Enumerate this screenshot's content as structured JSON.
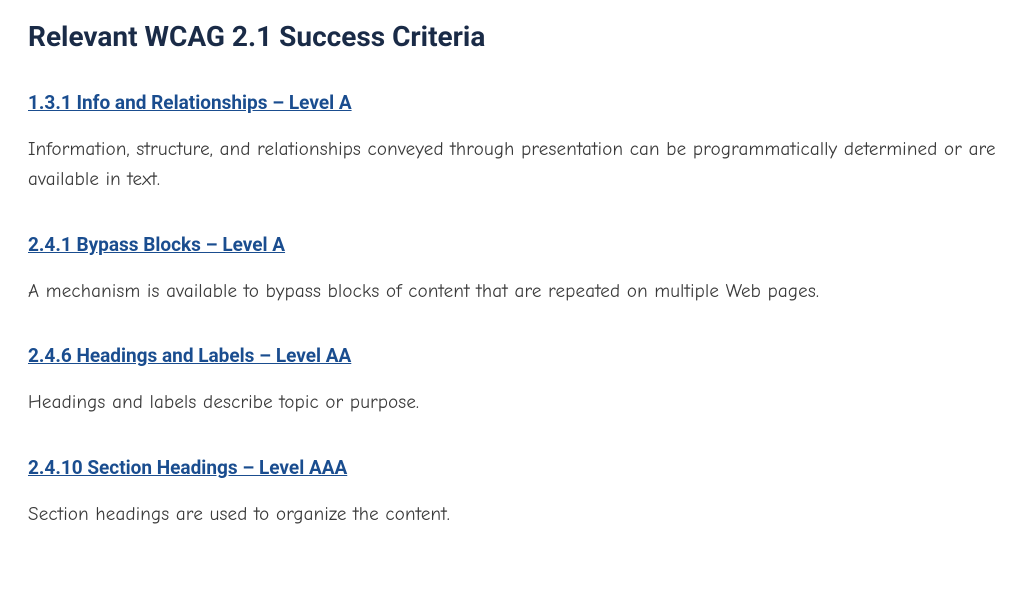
{
  "heading": "Relevant WCAG 2.1 Success Criteria",
  "criteria": [
    {
      "title": "1.3.1 Info and Relationships – Level A",
      "description": "Information, structure, and relationships conveyed through presentation can be programmatically determined or are available in text."
    },
    {
      "title": "2.4.1 Bypass Blocks – Level A",
      "description": "A mechanism is available to bypass blocks of content that are repeated on multiple Web pages."
    },
    {
      "title": "2.4.6 Headings and Labels – Level AA",
      "description": "Headings and labels describe topic or purpose."
    },
    {
      "title": "2.4.10 Section Headings – Level AAA",
      "description": "Section headings are used to organize the content."
    }
  ]
}
